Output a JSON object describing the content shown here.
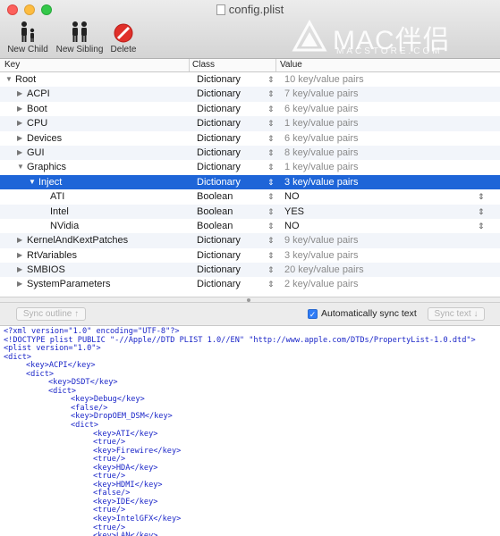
{
  "window": {
    "title": "config.plist"
  },
  "toolbar": {
    "new_child_label": "New Child",
    "new_sibling_label": "New Sibling",
    "delete_label": "Delete"
  },
  "watermark": {
    "text": "MAC伴侣",
    "sub": "MACSTORE.COM"
  },
  "outline": {
    "headers": {
      "key": "Key",
      "class": "Class",
      "value": "Value"
    },
    "rows": [
      {
        "key": "Root",
        "class": "Dictionary",
        "value": "10 key/value pairs",
        "depth": 0,
        "expander": "open",
        "muted": true,
        "stepper": true,
        "selected": false
      },
      {
        "key": "ACPI",
        "class": "Dictionary",
        "value": "7 key/value pairs",
        "depth": 1,
        "expander": "closed",
        "muted": true,
        "stepper": true,
        "selected": false
      },
      {
        "key": "Boot",
        "class": "Dictionary",
        "value": "6 key/value pairs",
        "depth": 1,
        "expander": "closed",
        "muted": true,
        "stepper": true,
        "selected": false
      },
      {
        "key": "CPU",
        "class": "Dictionary",
        "value": "1 key/value pairs",
        "depth": 1,
        "expander": "closed",
        "muted": true,
        "stepper": true,
        "selected": false
      },
      {
        "key": "Devices",
        "class": "Dictionary",
        "value": "6 key/value pairs",
        "depth": 1,
        "expander": "closed",
        "muted": true,
        "stepper": true,
        "selected": false
      },
      {
        "key": "GUI",
        "class": "Dictionary",
        "value": "8 key/value pairs",
        "depth": 1,
        "expander": "closed",
        "muted": true,
        "stepper": true,
        "selected": false
      },
      {
        "key": "Graphics",
        "class": "Dictionary",
        "value": "1 key/value pairs",
        "depth": 1,
        "expander": "open",
        "muted": true,
        "stepper": true,
        "selected": false
      },
      {
        "key": "Inject",
        "class": "Dictionary",
        "value": "3 key/value pairs",
        "depth": 2,
        "expander": "open",
        "muted": true,
        "stepper": true,
        "selected": true
      },
      {
        "key": "ATI",
        "class": "Boolean",
        "value": "NO",
        "depth": 3,
        "expander": "none",
        "muted": false,
        "stepper": true,
        "popup": true,
        "selected": false
      },
      {
        "key": "Intel",
        "class": "Boolean",
        "value": "YES",
        "depth": 3,
        "expander": "none",
        "muted": false,
        "stepper": true,
        "popup": true,
        "selected": false
      },
      {
        "key": "NVidia",
        "class": "Boolean",
        "value": "NO",
        "depth": 3,
        "expander": "none",
        "muted": false,
        "stepper": true,
        "popup": true,
        "selected": false
      },
      {
        "key": "KernelAndKextPatches",
        "class": "Dictionary",
        "value": "9 key/value pairs",
        "depth": 1,
        "expander": "closed",
        "muted": true,
        "stepper": true,
        "selected": false
      },
      {
        "key": "RtVariables",
        "class": "Dictionary",
        "value": "3 key/value pairs",
        "depth": 1,
        "expander": "closed",
        "muted": true,
        "stepper": true,
        "selected": false
      },
      {
        "key": "SMBIOS",
        "class": "Dictionary",
        "value": "20 key/value pairs",
        "depth": 1,
        "expander": "closed",
        "muted": true,
        "stepper": true,
        "selected": false
      },
      {
        "key": "SystemParameters",
        "class": "Dictionary",
        "value": "2 key/value pairs",
        "depth": 1,
        "expander": "closed",
        "muted": true,
        "stepper": true,
        "selected": false
      }
    ]
  },
  "syncbar": {
    "sync_outline_label": "Sync outline ↑",
    "auto_sync_label": "Automatically sync text",
    "auto_sync_checked": true,
    "sync_text_label": "Sync text ↓"
  },
  "text_view": {
    "lines": [
      {
        "indent": 0,
        "text": "<?xml version=\"1.0\" encoding=\"UTF-8\"?>"
      },
      {
        "indent": 0,
        "text": "<!DOCTYPE plist PUBLIC \"-//Apple//DTD PLIST 1.0//EN\" \"http://www.apple.com/DTDs/PropertyList-1.0.dtd\">"
      },
      {
        "indent": 0,
        "text": "<plist version=\"1.0\">"
      },
      {
        "indent": 0,
        "text": "<dict>"
      },
      {
        "indent": 1,
        "text": "<key>ACPI</key>"
      },
      {
        "indent": 1,
        "text": "<dict>"
      },
      {
        "indent": 2,
        "text": "<key>DSDT</key>"
      },
      {
        "indent": 2,
        "text": "<dict>"
      },
      {
        "indent": 3,
        "text": "<key>Debug</key>"
      },
      {
        "indent": 3,
        "text": "<false/>"
      },
      {
        "indent": 3,
        "text": "<key>DropOEM_DSM</key>"
      },
      {
        "indent": 3,
        "text": "<dict>"
      },
      {
        "indent": 4,
        "text": "<key>ATI</key>"
      },
      {
        "indent": 4,
        "text": "<true/>"
      },
      {
        "indent": 4,
        "text": "<key>Firewire</key>"
      },
      {
        "indent": 4,
        "text": "<true/>"
      },
      {
        "indent": 4,
        "text": "<key>HDA</key>"
      },
      {
        "indent": 4,
        "text": "<true/>"
      },
      {
        "indent": 4,
        "text": "<key>HDMI</key>"
      },
      {
        "indent": 4,
        "text": "<false/>"
      },
      {
        "indent": 4,
        "text": "<key>IDE</key>"
      },
      {
        "indent": 4,
        "text": "<true/>"
      },
      {
        "indent": 4,
        "text": "<key>IntelGFX</key>"
      },
      {
        "indent": 4,
        "text": "<true/>"
      },
      {
        "indent": 4,
        "text": "<key>LAN</key>"
      }
    ]
  },
  "colors": {
    "selection": "#1e65d8",
    "xml_tag": "#1b26c8",
    "checkbox": "#2f7cf6"
  }
}
